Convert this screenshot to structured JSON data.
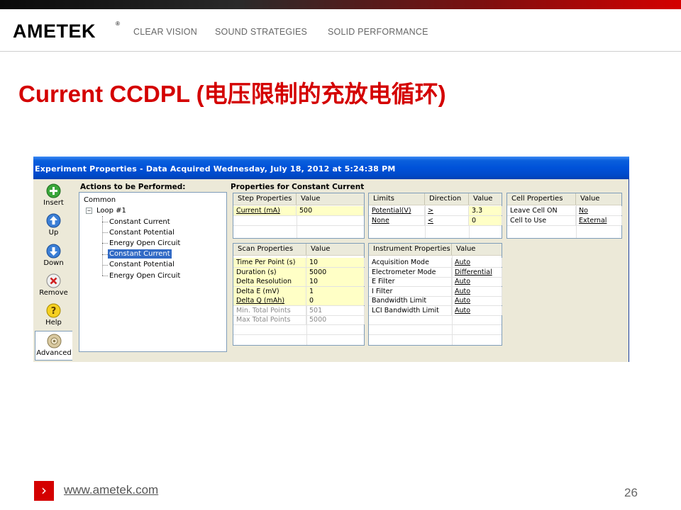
{
  "header": {
    "logo": "AMETEK",
    "logo_mark": "®",
    "taglines": [
      "CLEAR VISION",
      "SOUND STRATEGIES",
      "SOLID PERFORMANCE"
    ]
  },
  "slide": {
    "title": "Current CCDPL (电压限制的充放电循环)"
  },
  "window": {
    "title": "Experiment Properties - Data Acquired Wednesday, July 18, 2012 at 5:24:38 PM",
    "toolbar": [
      {
        "label": "Insert",
        "icon": "plus-icon"
      },
      {
        "label": "Up",
        "icon": "arrow-up-icon"
      },
      {
        "label": "Down",
        "icon": "arrow-down-icon"
      },
      {
        "label": "Remove",
        "icon": "remove-icon"
      },
      {
        "label": "Help",
        "icon": "help-icon"
      },
      {
        "label": "Advanced",
        "icon": "advanced-icon"
      }
    ],
    "actions_title": "Actions to be Performed:",
    "properties_title": "Properties for Constant Current",
    "tree": {
      "root": "Common",
      "loop": "Loop #1",
      "expander": "−",
      "children": [
        "Constant Current",
        "Constant Potential",
        "Energy Open Circuit",
        "Constant Current",
        "Constant Potential",
        "Energy Open Circuit"
      ],
      "selected_index": 3
    },
    "step_properties": {
      "headers": [
        "Step Properties",
        "Value"
      ],
      "rows": [
        [
          "Current (mA)",
          "500"
        ]
      ]
    },
    "limits": {
      "headers": [
        "Limits",
        "Direction",
        "Value"
      ],
      "rows": [
        [
          "Potential(V)",
          ">",
          "3.3"
        ],
        [
          "None",
          "<",
          "0"
        ]
      ]
    },
    "cell_properties": {
      "headers": [
        "Cell Properties",
        "Value"
      ],
      "rows": [
        [
          "Leave Cell ON",
          "No"
        ],
        [
          "Cell to Use",
          "External"
        ]
      ]
    },
    "scan_properties": {
      "headers": [
        "Scan Properties",
        "Value"
      ],
      "rows": [
        [
          "Time Per Point (s)",
          "10"
        ],
        [
          "Duration (s)",
          "5000"
        ],
        [
          "Delta Resolution",
          "10"
        ],
        [
          "Delta E (mV)",
          "1"
        ],
        [
          "Delta Q (mAh)",
          "0"
        ],
        [
          "Min. Total Points",
          "501"
        ],
        [
          "Max Total Points",
          "5000"
        ]
      ]
    },
    "instrument_properties": {
      "headers": [
        "Instrument Properties",
        "Value"
      ],
      "rows": [
        [
          "Acquisition Mode",
          "Auto"
        ],
        [
          "Electrometer Mode",
          "Differential"
        ],
        [
          "E Filter",
          "Auto"
        ],
        [
          "I Filter",
          "Auto"
        ],
        [
          "Bandwidth Limit",
          "Auto"
        ],
        [
          "LCI Bandwidth Limit",
          "Auto"
        ]
      ]
    }
  },
  "footer": {
    "arrow": "›",
    "url": "www.ametek.com",
    "page_number": "26"
  },
  "colors": {
    "brand_red": "#d40000",
    "titlebar_blue": "#0052d9",
    "selection_blue": "#316ac5",
    "value_highlight": "#ffffc6"
  }
}
